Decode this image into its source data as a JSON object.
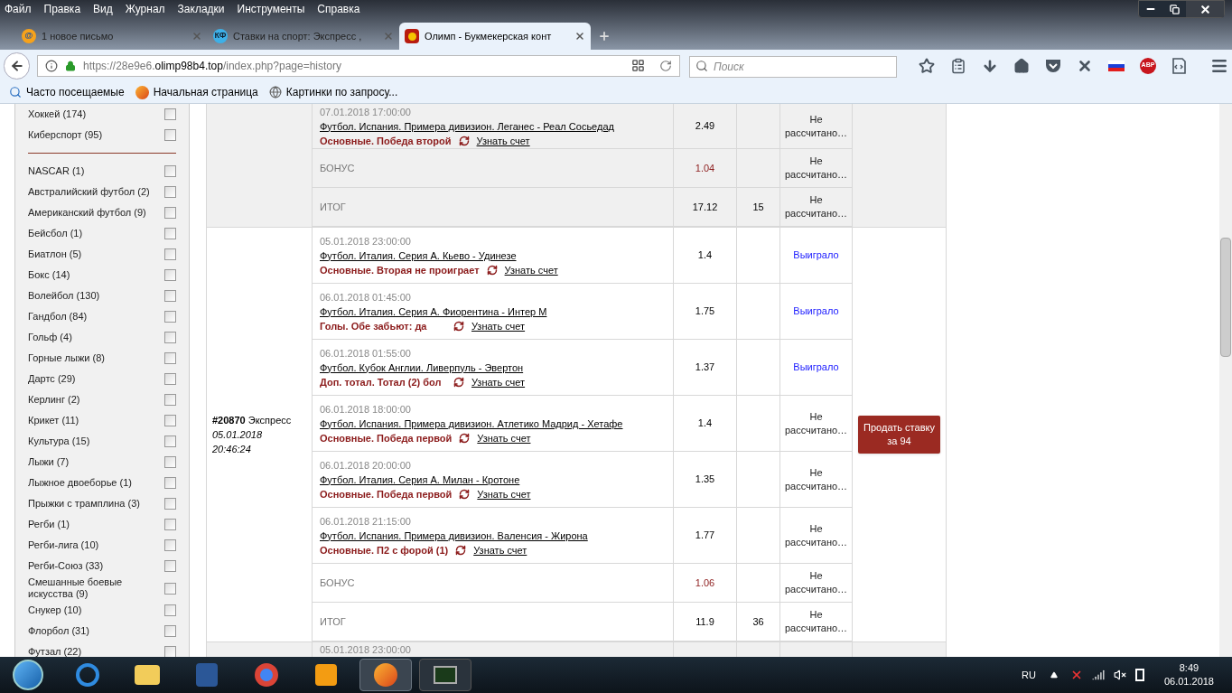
{
  "menu_bar": [
    "Файл",
    "Правка",
    "Вид",
    "Журнал",
    "Закладки",
    "Инструменты",
    "Справка"
  ],
  "tabs": [
    {
      "favicon_text": "@",
      "label": "1 новое письмо",
      "selected": false
    },
    {
      "favicon_text": "КФ",
      "label": "Ставки на спорт: Экспресс ,",
      "selected": false
    },
    {
      "label": "Олимп - Букмекерская конт",
      "selected": true
    }
  ],
  "address_bar": {
    "scheme": "https://",
    "host_prefix": "28e9e6.",
    "domain": "olimp98b4.top",
    "path": "/index.php?page=history"
  },
  "search": {
    "placeholder": "Поиск"
  },
  "abp_label": "ABP",
  "bookmarks": [
    "Часто посещаемые",
    "Начальная страница",
    "Картинки по запросу..."
  ],
  "sidebar": {
    "groups": [
      {
        "items": [
          {
            "label": "Хоккей (174)",
            "checked": false
          },
          {
            "label": "Киберспорт (95)",
            "checked": false
          }
        ]
      },
      {
        "items": [
          {
            "label": "NASCAR (1)",
            "checked": false
          },
          {
            "label": "Австралийский футбол (2)",
            "checked": false
          },
          {
            "label": "Американский футбол (9)",
            "checked": false
          },
          {
            "label": "Бейсбол (1)",
            "checked": false
          },
          {
            "label": "Биатлон (5)",
            "checked": false
          },
          {
            "label": "Бокс (14)",
            "checked": false
          },
          {
            "label": "Волейбол (130)",
            "checked": false
          },
          {
            "label": "Гандбол (84)",
            "checked": false
          },
          {
            "label": "Гольф (4)",
            "checked": false
          },
          {
            "label": "Горные лыжи (8)",
            "checked": false
          },
          {
            "label": "Дартс (29)",
            "checked": false
          },
          {
            "label": "Керлинг (2)",
            "checked": false
          },
          {
            "label": "Крикет (11)",
            "checked": false
          },
          {
            "label": "Культура (15)",
            "checked": false
          },
          {
            "label": "Лыжи (7)",
            "checked": false
          },
          {
            "label": "Лыжное двоеборье (1)",
            "checked": false
          },
          {
            "label": "Прыжки с трамплина (3)",
            "checked": false
          },
          {
            "label": "Регби (1)",
            "checked": false
          },
          {
            "label": "Регби-лига (10)",
            "checked": false
          },
          {
            "label": "Регби-Союз (33)",
            "checked": false
          },
          {
            "label": "Смешанные боевые искусства (9)",
            "checked": false
          },
          {
            "label": "Снукер (10)",
            "checked": false
          },
          {
            "label": "Флорбол (31)",
            "checked": false
          },
          {
            "label": "Футзал (22)",
            "checked": false
          }
        ]
      }
    ]
  },
  "bets": [
    {
      "shaded": true,
      "events": [
        {
          "date": "07.01.2018 17:00:00",
          "title": "Футбол. Испания. Примера дивизион. Леганес - Реал Сосьедад",
          "market": "Основные. Победа второй",
          "score_link": "Узнать счет",
          "coef": "2.49",
          "status": "Не рассчитано…",
          "kind": "pending"
        }
      ],
      "bonus": {
        "label": "БОНУС",
        "coef": "1.04",
        "status": "Не рассчитано…"
      },
      "total": {
        "label": "ИТОГ",
        "coef": "17.12",
        "column_4": "15",
        "status": "Не рассчитано…"
      }
    },
    {
      "shaded": false,
      "number": "#20870",
      "type": "Экспресс",
      "date": "05.01.2018",
      "time": "20:46:24",
      "sell_button": "Продать ставку за 94",
      "events": [
        {
          "date": "05.01.2018 23:00:00",
          "title": "Футбол. Италия. Серия А. Кьево - Удинезе",
          "market": "Основные. Вторая не проиграет",
          "score_link": "Узнать счет",
          "coef": "1.4",
          "status": "Выиграло",
          "kind": "won"
        },
        {
          "date": "06.01.2018 01:45:00",
          "title": "Футбол. Италия. Серия А. Фиорентина - Интер М",
          "market": "Голы. Обе забьют: да",
          "score_link": "Узнать счет",
          "coef": "1.75",
          "status": "Выиграло",
          "kind": "won"
        },
        {
          "date": "06.01.2018 01:55:00",
          "title": "Футбол. Кубок Англии. Ливерпуль - Эвертон",
          "market": "Доп. тотал. Тотал (2) бол",
          "score_link": "Узнать счет",
          "coef": "1.37",
          "status": "Выиграло",
          "kind": "won"
        },
        {
          "date": "06.01.2018 18:00:00",
          "title": "Футбол. Испания. Примера дивизион. Атлетико Мадрид - Хетафе",
          "market": "Основные. Победа первой",
          "score_link": "Узнать счет",
          "coef": "1.4",
          "status": "Не рассчитано…",
          "kind": "pending"
        },
        {
          "date": "06.01.2018 20:00:00",
          "title": "Футбол. Италия. Серия А. Милан - Кротоне",
          "market": "Основные. Победа первой",
          "score_link": "Узнать счет",
          "coef": "1.35",
          "status": "Не рассчитано…",
          "kind": "pending"
        },
        {
          "date": "06.01.2018 21:15:00",
          "title": "Футбол. Испания. Примера дивизион. Валенсия - Жирона",
          "market": "Основные. П2 с форой (1)",
          "score_link": "Узнать счет",
          "coef": "1.77",
          "status": "Не рассчитано…",
          "kind": "pending"
        }
      ],
      "bonus": {
        "label": "БОНУС",
        "coef": "1.06",
        "status": "Не рассчитано…"
      },
      "total": {
        "label": "ИТОГ",
        "coef": "11.9",
        "column_4": "36",
        "status": "Не рассчитано…"
      }
    },
    {
      "shaded": true,
      "events": [
        {
          "date": "05.01.2018 23:00:00"
        }
      ]
    }
  ],
  "taskbar": {
    "language": "RU",
    "time": "8:49",
    "date": "06.01.2018"
  }
}
